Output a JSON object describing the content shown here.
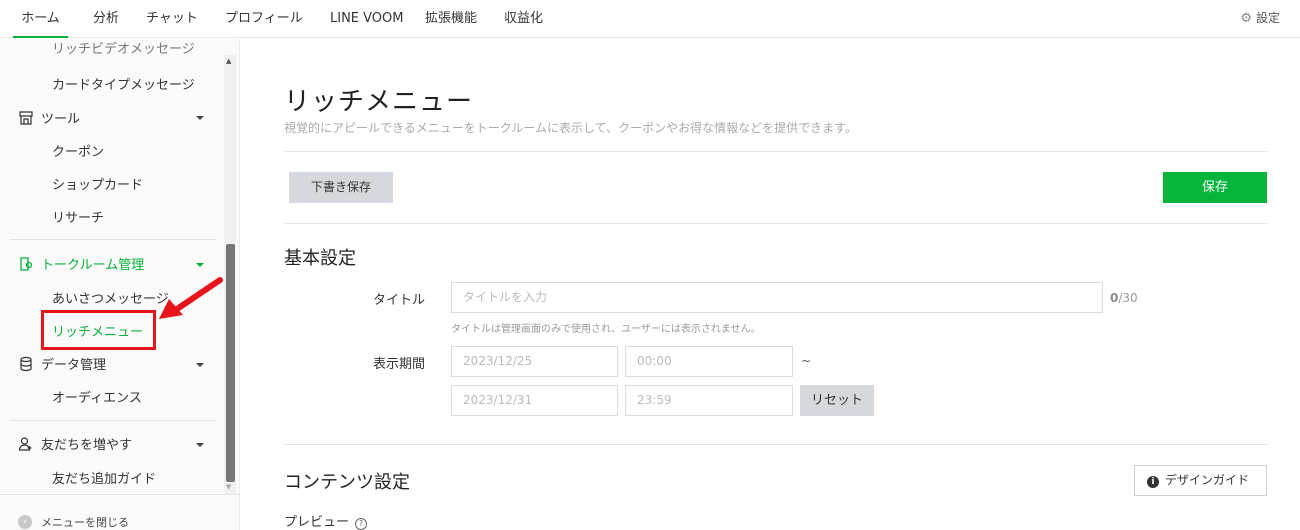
{
  "topnav": {
    "tabs": [
      {
        "label": "ホーム",
        "active": true
      },
      {
        "label": "分析",
        "active": false
      },
      {
        "label": "チャット",
        "active": false
      },
      {
        "label": "プロフィール",
        "active": false
      },
      {
        "label": "LINE VOOM",
        "active": false
      },
      {
        "label": "拡張機能",
        "active": false
      },
      {
        "label": "収益化",
        "active": false
      }
    ],
    "settings_label": "設定",
    "settings_icon": "gear-icon"
  },
  "sidebar": {
    "cut_item": "リッチビデオメッセージ",
    "card_message": "カードタイプメッセージ",
    "tools": {
      "label": "ツール",
      "icon": "shop-icon",
      "items": [
        "クーポン",
        "ショップカード",
        "リサーチ"
      ]
    },
    "talkroom": {
      "label": "トークルーム管理",
      "icon": "chat-manage-icon",
      "color": "#06b03a",
      "items": [
        "あいさつメッセージ",
        "リッチメニュー"
      ]
    },
    "data": {
      "label": "データ管理",
      "icon": "database-icon",
      "items": [
        "オーディエンス"
      ]
    },
    "friends": {
      "label": "友だちを増やす",
      "icon": "add-friend-icon",
      "items": [
        "友だち追加ガイド"
      ]
    },
    "collapse_label": "メニューを閉じる"
  },
  "main": {
    "title": "リッチメニュー",
    "description": "視覚的にアピールできるメニューをトークルームに表示して、クーポンやお得な情報などを提供できます。",
    "draft_button": "下書き保存",
    "save_button": "保存",
    "basic_section": "基本設定",
    "title_field": {
      "label": "タイトル",
      "placeholder": "タイトルを入力",
      "count": "0",
      "max": "/30",
      "hint": "タイトルは管理画面のみで使用され、ユーザーには表示されません。"
    },
    "period": {
      "label": "表示期間",
      "start_date": "2023/12/25",
      "start_time": "00:00",
      "separator": "~",
      "end_date": "2023/12/31",
      "end_time": "23:59",
      "reset_button": "リセット"
    },
    "content_section": "コンテンツ設定",
    "design_guide_button": "デザインガイド",
    "preview_label": "プレビュー"
  },
  "colors": {
    "accent": "#06b03a",
    "save_button": "#07b53b",
    "annotation": "#e8141c"
  }
}
